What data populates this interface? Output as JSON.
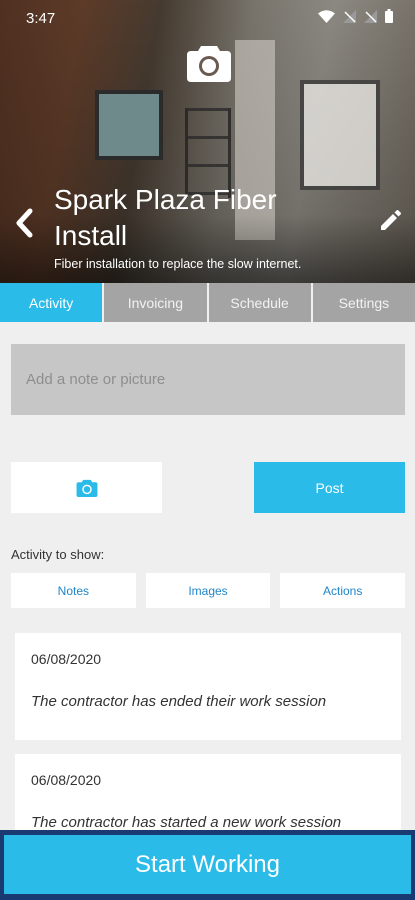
{
  "status_bar": {
    "time": "3:47",
    "icons": [
      "wifi-icon",
      "no-signal-icon",
      "no-signal-icon",
      "battery-icon"
    ]
  },
  "header": {
    "title": "Spark Plaza Fiber Install",
    "subtitle": "Fiber installation to replace the slow internet.",
    "camera_icon": "camera-icon",
    "back_icon": "chevron-left-icon",
    "edit_icon": "pencil-icon"
  },
  "tabs": [
    {
      "label": "Activity",
      "active": true
    },
    {
      "label": "Invoicing",
      "active": false
    },
    {
      "label": "Schedule",
      "active": false
    },
    {
      "label": "Settings",
      "active": false
    }
  ],
  "note": {
    "placeholder": "Add a note or picture",
    "value": ""
  },
  "actions": {
    "photo_icon": "camera-icon",
    "post_label": "Post"
  },
  "activity_filter": {
    "label": "Activity to show:",
    "options": [
      "Notes",
      "Images",
      "Actions"
    ]
  },
  "feed": [
    {
      "date": "06/08/2020",
      "text": "The contractor has ended their work session"
    },
    {
      "date": "06/08/2020",
      "text": "The contractor has started a new work session"
    }
  ],
  "start_button": {
    "label": "Start Working"
  },
  "colors": {
    "accent": "#2bbbe8",
    "tab_inactive": "#a4a4a4",
    "link": "#1f86c8",
    "start_border": "#1a3a73"
  }
}
